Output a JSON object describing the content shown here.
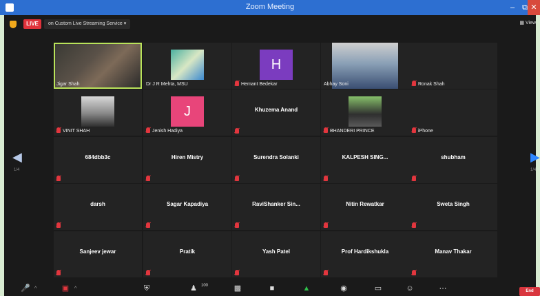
{
  "window": {
    "title": "Zoom Meeting"
  },
  "topbar": {
    "live_badge": "LIVE",
    "streaming_label": "on Custom Live Streaming Service ▾",
    "view_label": "View"
  },
  "gallery": {
    "page_left": "1/4",
    "page_right": "1/4",
    "tiles": [
      {
        "name": "Jigar Shah",
        "kind": "video",
        "active": true
      },
      {
        "name": "Dr J R Mehta, MSU",
        "kind": "photo",
        "muted": false
      },
      {
        "name": "Hemant Bedekar",
        "kind": "letter",
        "letter": "H",
        "letter_color": "#7b3cbf",
        "muted": true
      },
      {
        "name": "Abhay Soni",
        "kind": "video",
        "muted": false
      },
      {
        "name": "Ronak Shah",
        "kind": "none",
        "muted": true
      },
      {
        "name": "VINIT SHAH",
        "kind": "photo",
        "muted": true
      },
      {
        "name": "Jenish Hadiya",
        "kind": "letter",
        "letter": "J",
        "letter_color": "#e8457a",
        "muted": true
      },
      {
        "name": "Khuzema Anand",
        "kind": "center",
        "muted": true
      },
      {
        "name": "BHANDERI PRINCE",
        "kind": "photo",
        "muted": true
      },
      {
        "name": "iPhone",
        "kind": "none",
        "muted": true
      },
      {
        "name": "684dbb3c",
        "kind": "center",
        "muted": true
      },
      {
        "name": "Hiren Mistry",
        "kind": "center",
        "muted": true
      },
      {
        "name": "Surendra Solanki",
        "kind": "center",
        "muted": true
      },
      {
        "name": "KALPESH  SING...",
        "kind": "center",
        "muted": true
      },
      {
        "name": "shubham",
        "kind": "center",
        "muted": true
      },
      {
        "name": "darsh",
        "kind": "center",
        "muted": true
      },
      {
        "name": "Sagar Kapadiya",
        "kind": "center",
        "muted": true
      },
      {
        "name": "RaviShanker  Sin...",
        "kind": "center",
        "muted": true
      },
      {
        "name": "Nitin Rewatkar",
        "kind": "center",
        "muted": true
      },
      {
        "name": "Sweta Singh",
        "kind": "center",
        "muted": true
      },
      {
        "name": "Sanjeev jewar",
        "kind": "center",
        "muted": true
      },
      {
        "name": "Pratik",
        "kind": "center",
        "muted": true
      },
      {
        "name": "Yash Patel",
        "kind": "center",
        "muted": true
      },
      {
        "name": "Prof Hardikshukla",
        "kind": "center",
        "muted": true
      },
      {
        "name": "Manav Thakar",
        "kind": "center",
        "muted": true
      }
    ]
  },
  "toolbar": {
    "participants_count": "100",
    "end_label": "End"
  }
}
